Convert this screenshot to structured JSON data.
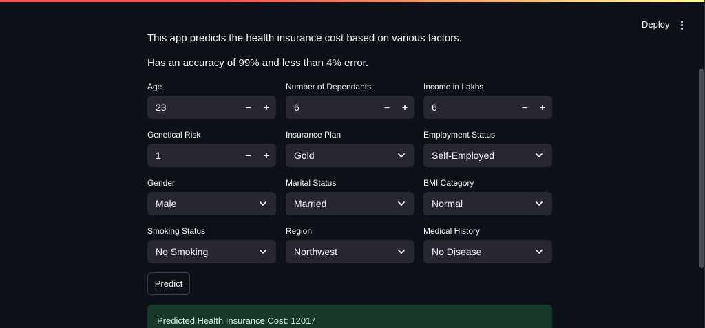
{
  "header": {
    "deploy_label": "Deploy",
    "menu_icon": "kebab-menu-icon"
  },
  "intro": {
    "line1": "This app predicts the health insurance cost based on various factors.",
    "line2": "Has an accuracy of 99% and less than 4% error."
  },
  "form": {
    "age": {
      "label": "Age",
      "value": "23"
    },
    "dependants": {
      "label": "Number of Dependants",
      "value": "6"
    },
    "income": {
      "label": "Income in Lakhs",
      "value": "6"
    },
    "genetical_risk": {
      "label": "Genetical Risk",
      "value": "1"
    },
    "insurance_plan": {
      "label": "Insurance Plan",
      "value": "Gold"
    },
    "employment_status": {
      "label": "Employment Status",
      "value": "Self-Employed"
    },
    "gender": {
      "label": "Gender",
      "value": "Male"
    },
    "marital_status": {
      "label": "Marital Status",
      "value": "Married"
    },
    "bmi_category": {
      "label": "BMI Category",
      "value": "Normal"
    },
    "smoking_status": {
      "label": "Smoking Status",
      "value": "No Smoking"
    },
    "region": {
      "label": "Region",
      "value": "Northwest"
    },
    "medical_history": {
      "label": "Medical History",
      "value": "No Disease"
    },
    "minus_symbol": "−",
    "plus_symbol": "+"
  },
  "predict_label": "Predict",
  "result": {
    "text": "Predicted Health Insurance Cost: 12017"
  },
  "colors": {
    "background": "#0e1117",
    "input_bg": "#262730",
    "success_bg": "#173928",
    "accent": "#ff4b4b"
  }
}
